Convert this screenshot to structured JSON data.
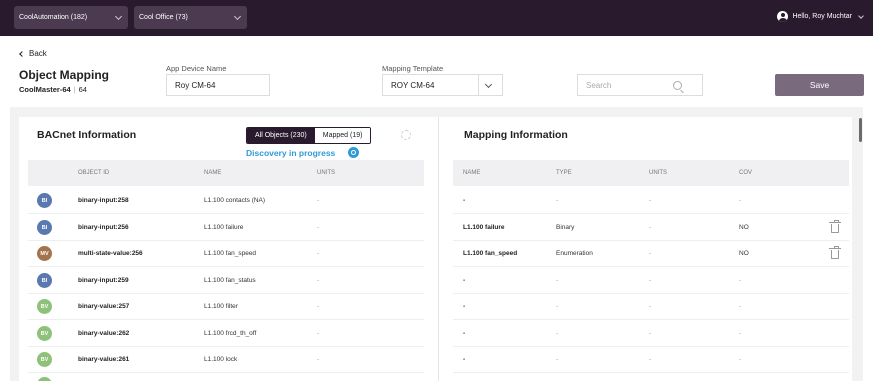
{
  "topbar": {
    "site_dropdown": "CoolAutomation (182)",
    "office_dropdown": "Cool Office (73)",
    "user_greeting": "Hello, Roy Muchtar"
  },
  "header": {
    "back_label": "Back",
    "title": "Object Mapping",
    "device_model": "CoolMaster-64",
    "device_number": "64",
    "app_device_name_label": "App Device Name",
    "app_device_name_value": "Roy CM-64",
    "mapping_template_label": "Mapping Template",
    "mapping_template_value": "ROY CM-64",
    "search_placeholder": "Search",
    "save_label": "Save"
  },
  "bacnet": {
    "title": "BACnet Information",
    "tab_all": "All Objects (230)",
    "tab_mapped": "Mapped (19)",
    "discovery_status": "Discovery in progress",
    "columns": [
      "OBJECT ID",
      "NAME",
      "UNITS"
    ],
    "rows": [
      {
        "badge": "BI",
        "object_id": "binary-input:258",
        "name": "L1.100 contacts (NA)",
        "units": "-"
      },
      {
        "badge": "BI",
        "object_id": "binary-input:256",
        "name": "L1.100 failure",
        "units": "-"
      },
      {
        "badge": "MV",
        "object_id": "multi-state-value:256",
        "name": "L1.100 fan_speed",
        "units": "-"
      },
      {
        "badge": "BI",
        "object_id": "binary-input:259",
        "name": "L1.100 fan_status",
        "units": "-"
      },
      {
        "badge": "BV",
        "object_id": "binary-value:257",
        "name": "L1.100 filter",
        "units": "-"
      },
      {
        "badge": "BV",
        "object_id": "binary-value:262",
        "name": "L1.100 frcd_th_off",
        "units": "-"
      },
      {
        "badge": "BV",
        "object_id": "binary-value:261",
        "name": "L1.100 lock",
        "units": "-"
      }
    ]
  },
  "mapping": {
    "title": "Mapping Information",
    "columns": [
      "NAME",
      "TYPE",
      "UNITS",
      "COV"
    ],
    "rows": [
      {
        "name": "-",
        "type": "-",
        "units": "-",
        "cov": "-",
        "delete": false
      },
      {
        "name": "L1.100 failure",
        "type": "Binary",
        "units": "-",
        "cov": "NO",
        "delete": true
      },
      {
        "name": "L1.100 fan_speed",
        "type": "Enumeration",
        "units": "-",
        "cov": "NO",
        "delete": true
      },
      {
        "name": "-",
        "type": "-",
        "units": "-",
        "cov": "-",
        "delete": false
      },
      {
        "name": "-",
        "type": "-",
        "units": "-",
        "cov": "-",
        "delete": false
      },
      {
        "name": "-",
        "type": "-",
        "units": "-",
        "cov": "-",
        "delete": false
      },
      {
        "name": "-",
        "type": "-",
        "units": "-",
        "cov": "-",
        "delete": false
      }
    ]
  },
  "colors": {
    "topbar": "#2a1a2e",
    "badge_BI": "#5a79b0",
    "badge_MV": "#a3744c",
    "badge_BV": "#8ec27a",
    "discovery": "#2e9bd6",
    "save_button": "#7a6a7e"
  },
  "icons": [
    "chevron-down-icon",
    "user-avatar-icon",
    "back-arrow-icon",
    "search-icon",
    "refresh-icon",
    "discovery-icon",
    "trash-icon"
  ]
}
